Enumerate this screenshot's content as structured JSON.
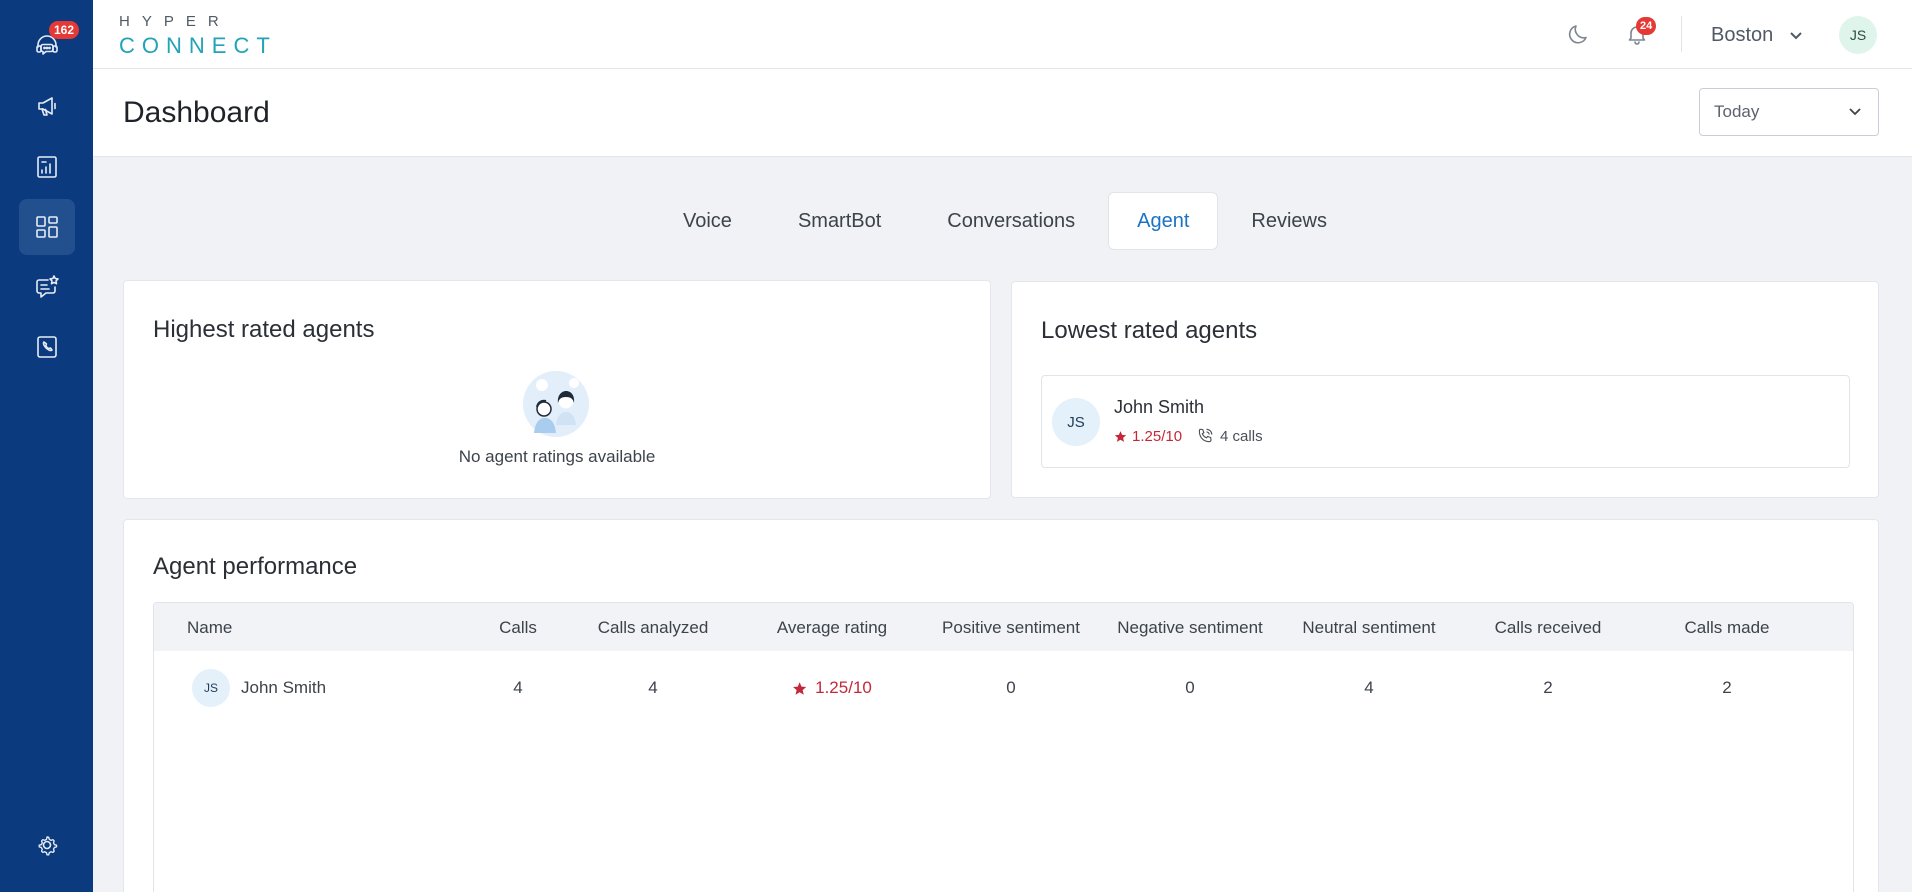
{
  "sidebar": {
    "support_badge": "162",
    "items": [
      {
        "icon": "headset-icon"
      },
      {
        "icon": "megaphone-icon"
      },
      {
        "icon": "report-icon"
      },
      {
        "icon": "dashboard-icon",
        "active": true
      },
      {
        "icon": "chat-star-icon"
      },
      {
        "icon": "phone-book-icon"
      }
    ],
    "settings_icon": "gear-icon"
  },
  "header": {
    "logo_top": "HYPER",
    "logo_bottom": "CONNECT",
    "notification_badge": "24",
    "city": "Boston",
    "user_initials": "JS"
  },
  "page": {
    "title": "Dashboard",
    "date_filter": "Today"
  },
  "tabs": [
    "Voice",
    "SmartBot",
    "Conversations",
    "Agent",
    "Reviews"
  ],
  "active_tab": "Agent",
  "highest_rated": {
    "title": "Highest rated agents",
    "empty_text": "No agent ratings available"
  },
  "lowest_rated": {
    "title": "Lowest rated agents",
    "agent": {
      "initials": "JS",
      "name": "John Smith",
      "rating": "1.25/10",
      "calls": "4 calls"
    }
  },
  "performance": {
    "title": "Agent performance",
    "columns": [
      "Name",
      "Calls",
      "Calls analyzed",
      "Average rating",
      "Positive sentiment",
      "Negative sentiment",
      "Neutral sentiment",
      "Calls received",
      "Calls made"
    ],
    "rows": [
      {
        "initials": "JS",
        "name": "John Smith",
        "calls": "4",
        "calls_analyzed": "4",
        "average_rating": "1.25/10",
        "positive": "0",
        "negative": "0",
        "neutral": "4",
        "received": "2",
        "made": "2"
      }
    ]
  },
  "colors": {
    "sidebar": "#0c3a7e",
    "accent": "#1a73c4",
    "rating_red": "#c3283a",
    "badge_red": "#e53935"
  }
}
